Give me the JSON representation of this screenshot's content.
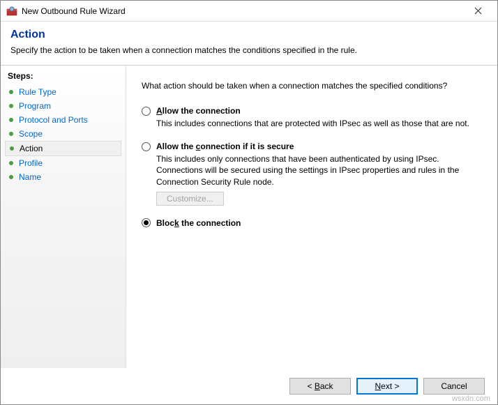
{
  "titlebar": {
    "title": "New Outbound Rule Wizard"
  },
  "header": {
    "heading": "Action",
    "subtitle": "Specify the action to be taken when a connection matches the conditions specified in the rule."
  },
  "steps": {
    "label": "Steps:",
    "items": [
      {
        "label": "Rule Type",
        "current": false
      },
      {
        "label": "Program",
        "current": false
      },
      {
        "label": "Protocol and Ports",
        "current": false
      },
      {
        "label": "Scope",
        "current": false
      },
      {
        "label": "Action",
        "current": true
      },
      {
        "label": "Profile",
        "current": false
      },
      {
        "label": "Name",
        "current": false
      }
    ]
  },
  "content": {
    "prompt": "What action should be taken when a connection matches the specified conditions?",
    "options": {
      "allow": {
        "label_pre": "A",
        "label_post": "llow the connection",
        "desc": "This includes connections that are protected with IPsec as well as those that are not.",
        "selected": false
      },
      "allow_secure": {
        "label_pre": "Allow the ",
        "label_u": "c",
        "label_post": "onnection if it is secure",
        "desc": "This includes only connections that have been authenticated by using IPsec. Connections will be secured using the settings in IPsec properties and rules in the Connection Security Rule node.",
        "selected": false
      },
      "block": {
        "label_pre": "Bloc",
        "label_u": "k",
        "label_post": " the connection",
        "selected": true
      }
    },
    "customize": "Customize..."
  },
  "footer": {
    "back_pre": "< ",
    "back_u": "B",
    "back_post": "ack",
    "next_pre": "",
    "next_u": "N",
    "next_post": "ext >",
    "cancel": "Cancel"
  },
  "watermark": "wsxdn.com"
}
